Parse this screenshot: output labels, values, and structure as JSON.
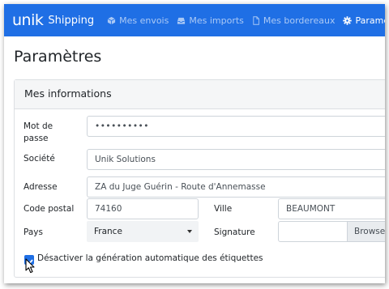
{
  "navbar": {
    "brand_logo": "unik",
    "brand_name": "Shipping",
    "items": [
      {
        "label": "Mes envois",
        "icon": "cube-icon",
        "active": false
      },
      {
        "label": "Mes imports",
        "icon": "inbox-icon",
        "active": false
      },
      {
        "label": "Mes bordereaux",
        "icon": "file-icon",
        "active": false
      },
      {
        "label": "Paramètres",
        "icon": "gear-icon",
        "active": true
      }
    ],
    "color": "#1f6fe5"
  },
  "page": {
    "title": "Paramètres"
  },
  "card": {
    "title": "Mes informations",
    "fields": {
      "password": {
        "label": "Mot de passe",
        "value": "••••••••••"
      },
      "company": {
        "label": "Société",
        "value": "Unik Solutions"
      },
      "address": {
        "label": "Adresse",
        "value": "ZA du Juge Guérin - Route d'Annemasse"
      },
      "postal_code": {
        "label": "Code postal",
        "value": "74160"
      },
      "city": {
        "label": "Ville",
        "value": "BEAUMONT"
      },
      "country": {
        "label": "Pays",
        "value": "France"
      },
      "signature": {
        "label": "Signature",
        "browse_label": "Browse"
      }
    },
    "checkbox": {
      "label": "Désactiver la génération automatique des étiquettes",
      "checked": true
    }
  }
}
